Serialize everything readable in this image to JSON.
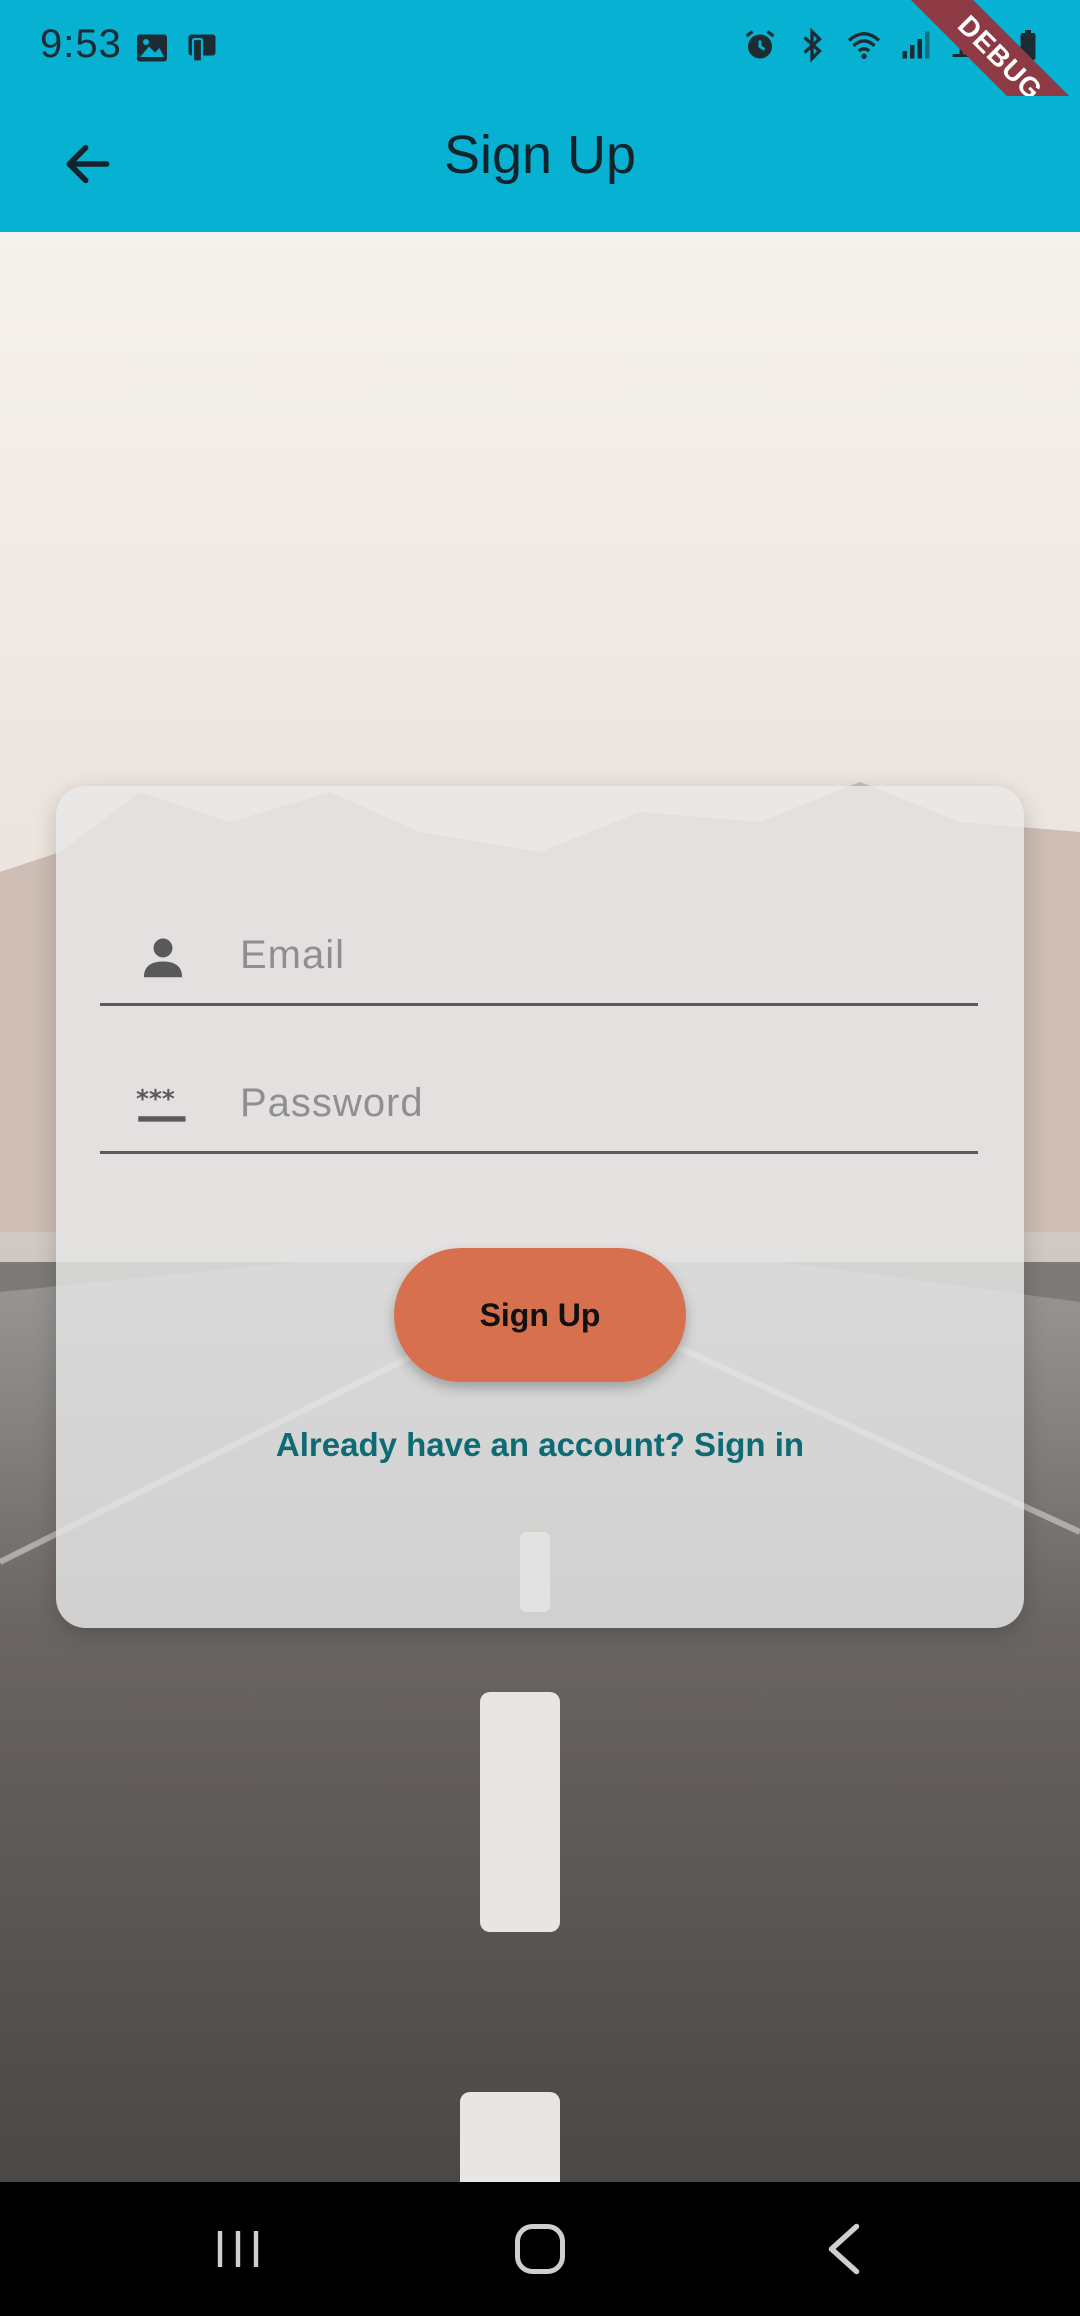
{
  "status_bar": {
    "time": "9:53",
    "battery_text": "14",
    "left_icons": [
      "image-icon",
      "device-icon"
    ],
    "right_icons": [
      "alarm-icon",
      "bluetooth-icon",
      "wifi-icon",
      "signal-icon",
      "battery-icon"
    ]
  },
  "debug_banner": "DEBUG",
  "app_bar": {
    "title": "Sign Up",
    "back_icon": "arrow-left-icon"
  },
  "form": {
    "email": {
      "placeholder": "Email",
      "value": "",
      "icon": "person-icon"
    },
    "password": {
      "placeholder": "Password",
      "value": "",
      "icon": "password-icon"
    },
    "submit_label": "Sign Up",
    "signin_link": "Already have an account? Sign in"
  },
  "nav_bar": {
    "buttons": [
      "recents-icon",
      "home-icon",
      "back-icon"
    ]
  },
  "colors": {
    "app_bar": "#06b1d2",
    "button": "#d6704e",
    "link": "#0e6a74",
    "debug": "#8e3a44"
  }
}
